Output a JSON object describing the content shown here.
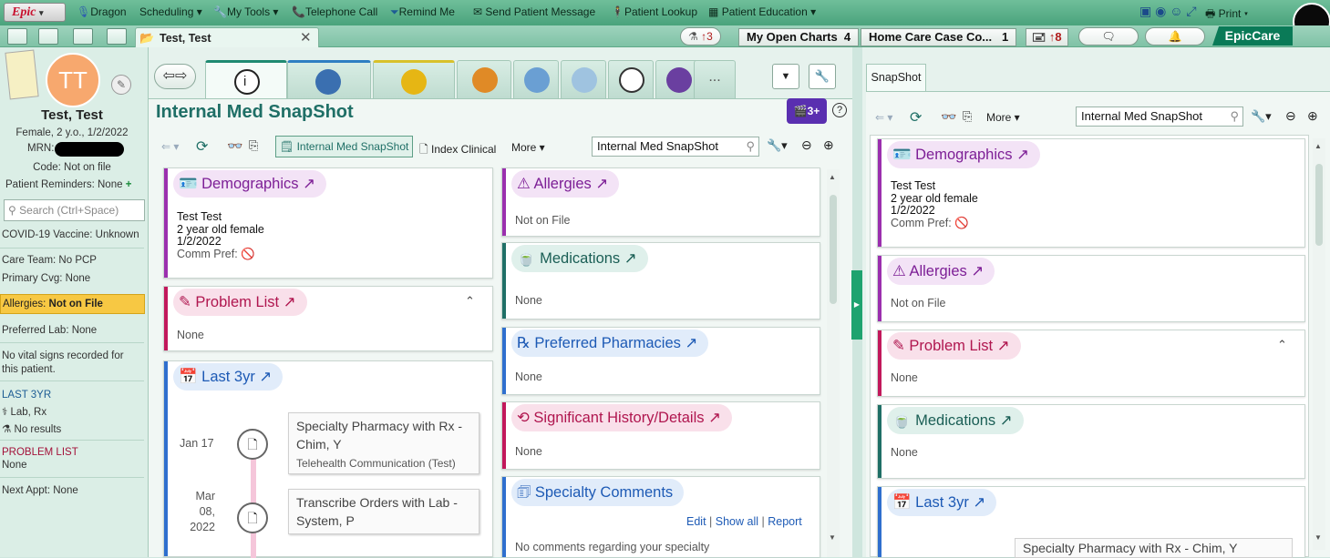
{
  "topbar": {
    "epic_label": "Epic",
    "items": [
      "Dragon",
      "Scheduling",
      "My Tools",
      "Telephone Call",
      "Remind Me",
      "Send Patient Message",
      "Patient Lookup",
      "Patient Education"
    ],
    "print_label": "Print"
  },
  "bar2": {
    "patient_tab": "Test, Test",
    "lab_alert": "↑3",
    "open_charts_label": "My Open Charts",
    "open_charts_count": "4",
    "home_care_label": "Home Care Case Co...",
    "home_care_count": "1",
    "inbox_alert": "↑8",
    "epiccare_label": "EpicCare"
  },
  "sidebar": {
    "initials": "TT",
    "name": "Test, Test",
    "demographics": "Female, 2 y.o., 1/2/2022",
    "mrn_label": "MRN:",
    "code_status": "Code: Not on file",
    "reminders": "Patient Reminders: None",
    "reminders_add": "+",
    "search_placeholder": "Search (Ctrl+Space)",
    "covid": "COVID-19 Vaccine: Unknown",
    "care_team": "Care Team: No PCP",
    "primary_cvg": "Primary Cvg: None",
    "allergies_label": "Allergies:",
    "allergies_value": "Not on File",
    "preferred_lab": "Preferred Lab: None",
    "vitals_line1": "No vital signs recorded for",
    "vitals_line2": "this patient.",
    "last3yr_heading": "LAST 3YR",
    "last3yr_types": "Lab, Rx",
    "last3yr_results": "No results",
    "problem_heading": "PROBLEM LIST",
    "problem_value": "None",
    "next_appt": "Next Appt: None"
  },
  "center": {
    "title": "Internal Med SnapShot",
    "badge": "3+",
    "toolbar_report": "Internal Med SnapShot",
    "toolbar_index": "Index Clinical",
    "toolbar_more": "More",
    "search_value": "Internal Med SnapShot",
    "more_tabs": "...",
    "demographics": {
      "title": "Demographics",
      "name": "Test Test",
      "age_sex": "2 year old female",
      "dob": "1/2/2022",
      "comm_pref": "Comm Pref:"
    },
    "problem_list": {
      "title": "Problem List",
      "value": "None"
    },
    "last3yr": {
      "title": "Last 3yr",
      "entries": [
        {
          "date": "Jan 17",
          "title_line1": "Specialty Pharmacy with Rx -",
          "title_line2": "Chim, Y",
          "sub": "Telehealth Communication (Test)"
        },
        {
          "date_line1": "Mar",
          "date_line2": "08,",
          "date_line3": "2022",
          "title_line1": "Transcribe Orders with Lab -",
          "title_line2": "System, P"
        }
      ]
    },
    "allergies": {
      "title": "Allergies",
      "value": "Not on File"
    },
    "medications": {
      "title": "Medications",
      "value": "None"
    },
    "pharmacies": {
      "title": "Preferred Pharmacies",
      "value": "None"
    },
    "history": {
      "title": "Significant History/Details",
      "value": "None"
    },
    "specialty": {
      "title": "Specialty Comments",
      "edit": "Edit",
      "show_all": "Show all",
      "report": "Report",
      "sep": "|",
      "value": "No comments regarding your specialty"
    }
  },
  "right": {
    "tab": "SnapShot",
    "toolbar_more": "More",
    "search_value": "Internal Med SnapShot",
    "demographics": {
      "title": "Demographics",
      "name": "Test Test",
      "age_sex": "2 year old female",
      "dob": "1/2/2022",
      "comm_pref": "Comm Pref:"
    },
    "allergies": {
      "title": "Allergies",
      "value": "Not on File"
    },
    "problem_list": {
      "title": "Problem List",
      "value": "None"
    },
    "medications": {
      "title": "Medications",
      "value": "None"
    },
    "last3yr": {
      "title": "Last 3yr",
      "entry": "Specialty Pharmacy with Rx - Chim, Y"
    }
  },
  "colors": {
    "purple": "#9b2fae",
    "pink": "#c2185b",
    "teal": "#1f6f66",
    "blue": "#2f6fce",
    "accent_green": "#0a7a57"
  }
}
